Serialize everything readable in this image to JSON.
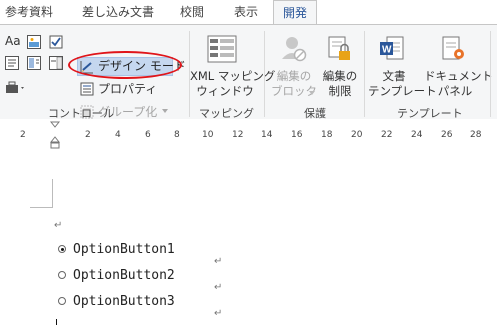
{
  "tabs": [
    {
      "label": "参考資料"
    },
    {
      "label": "差し込み文書"
    },
    {
      "label": "校閲"
    },
    {
      "label": "表示"
    },
    {
      "label": "開発"
    }
  ],
  "ribbon": {
    "controls_group": {
      "label": "コントロール",
      "design_mode": "デザイン モード",
      "properties": "プロパティ",
      "group": "グループ化"
    },
    "mapping_group": {
      "label": "マッピング",
      "xml_mapping_line1": "XML マッピング",
      "xml_mapping_line2": "ウィンドウ"
    },
    "protect_group": {
      "label": "保護",
      "block_authors_line1": "編集の",
      "block_authors_line2": "ブロック",
      "restrict_editing_line1": "編集の",
      "restrict_editing_line2": "制限"
    },
    "templates_group": {
      "label": "テンプレート",
      "doc_template_line1": "文書",
      "doc_template_line2": "テンプレート",
      "doc_panel_line1": "ドキュメント",
      "doc_panel_line2": "パネル"
    },
    "accent": "#2b579a",
    "highlight_color": "#e0151a"
  },
  "ruler": {
    "labels": [
      "2",
      "2",
      "4",
      "6",
      "8",
      "10",
      "12",
      "14",
      "16",
      "18",
      "20",
      "22",
      "24",
      "26",
      "28"
    ]
  },
  "document": {
    "options": [
      {
        "label": "OptionButton1",
        "selected": true
      },
      {
        "label": "OptionButton2",
        "selected": false
      },
      {
        "label": "OptionButton3",
        "selected": false
      }
    ],
    "para_mark": "↵"
  }
}
